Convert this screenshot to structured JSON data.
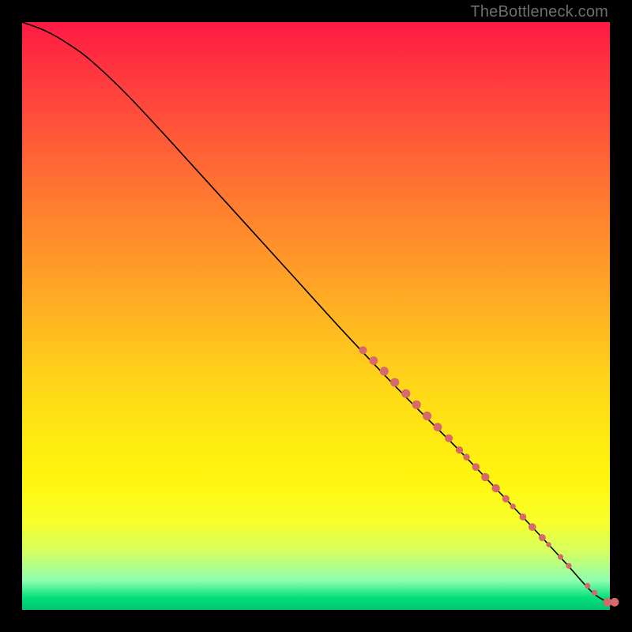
{
  "watermark": "TheBottleneck.com",
  "chart_data": {
    "type": "line",
    "title": "",
    "xlabel": "",
    "ylabel": "",
    "xlim": [
      0,
      100
    ],
    "ylim": [
      0,
      100
    ],
    "grid": false,
    "curve": [
      {
        "x": 0,
        "y": 100
      },
      {
        "x": 4,
        "y": 98.5
      },
      {
        "x": 8,
        "y": 96.2
      },
      {
        "x": 12,
        "y": 93.2
      },
      {
        "x": 18,
        "y": 87.5
      },
      {
        "x": 25,
        "y": 80.0
      },
      {
        "x": 35,
        "y": 69.0
      },
      {
        "x": 45,
        "y": 58.0
      },
      {
        "x": 55,
        "y": 47.0
      },
      {
        "x": 65,
        "y": 36.5
      },
      {
        "x": 75,
        "y": 26.5
      },
      {
        "x": 85,
        "y": 16.0
      },
      {
        "x": 92,
        "y": 8.5
      },
      {
        "x": 97,
        "y": 3.0
      },
      {
        "x": 100,
        "y": 1.2
      }
    ],
    "points_desc": "Scatter markers clustered along lower-right portion of the descending curve",
    "points": [
      {
        "x": 58.0,
        "y": 44.2,
        "r": 5.0
      },
      {
        "x": 59.8,
        "y": 42.4,
        "r": 5.4
      },
      {
        "x": 61.6,
        "y": 40.6,
        "r": 5.6
      },
      {
        "x": 63.4,
        "y": 38.7,
        "r": 5.6
      },
      {
        "x": 65.3,
        "y": 36.8,
        "r": 5.6
      },
      {
        "x": 67.1,
        "y": 34.9,
        "r": 5.6
      },
      {
        "x": 68.9,
        "y": 33.0,
        "r": 5.6
      },
      {
        "x": 70.7,
        "y": 31.1,
        "r": 5.4
      },
      {
        "x": 72.6,
        "y": 29.2,
        "r": 5.0
      },
      {
        "x": 74.4,
        "y": 27.2,
        "r": 4.6
      },
      {
        "x": 75.6,
        "y": 26.0,
        "r": 4.2
      },
      {
        "x": 77.2,
        "y": 24.3,
        "r": 4.8
      },
      {
        "x": 78.8,
        "y": 22.6,
        "r": 5.2
      },
      {
        "x": 80.6,
        "y": 20.7,
        "r": 5.2
      },
      {
        "x": 82.3,
        "y": 18.9,
        "r": 4.6
      },
      {
        "x": 83.5,
        "y": 17.6,
        "r": 3.6
      },
      {
        "x": 85.2,
        "y": 15.8,
        "r": 4.4
      },
      {
        "x": 86.8,
        "y": 14.1,
        "r": 4.8
      },
      {
        "x": 88.5,
        "y": 12.3,
        "r": 4.4
      },
      {
        "x": 89.6,
        "y": 11.1,
        "r": 3.2
      },
      {
        "x": 91.6,
        "y": 9.0,
        "r": 3.6
      },
      {
        "x": 93.0,
        "y": 7.5,
        "r": 3.6
      },
      {
        "x": 96.2,
        "y": 4.1,
        "r": 3.6
      },
      {
        "x": 97.4,
        "y": 2.9,
        "r": 3.6
      },
      {
        "x": 99.6,
        "y": 1.3,
        "r": 5.4
      },
      {
        "x": 100.8,
        "y": 1.3,
        "r": 5.4
      }
    ]
  }
}
